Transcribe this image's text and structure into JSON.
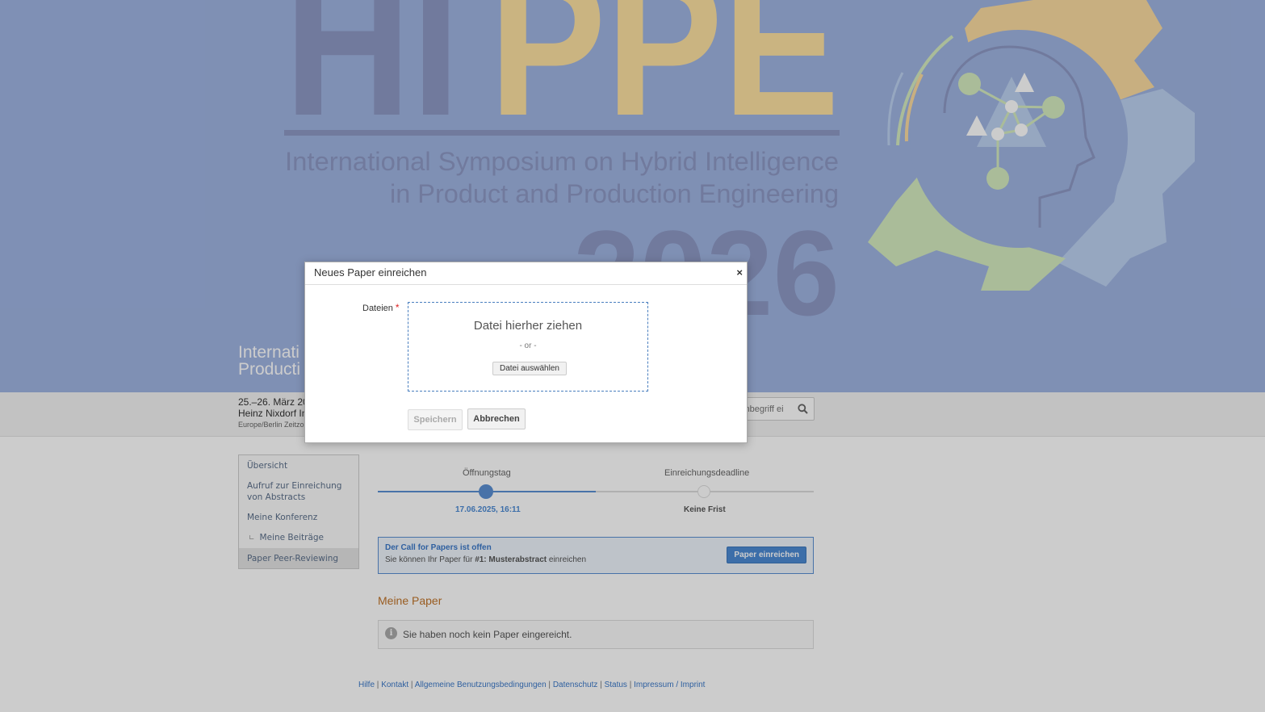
{
  "banner": {
    "logo_text": "HIPPE",
    "logo_subtitle_line1": "International Symposium on Hybrid Intelligence",
    "logo_subtitle_line2": "in Product and Production Engineering",
    "logo_year": "2026",
    "conference_title_line1": "Internati",
    "conference_title_line2": "Producti"
  },
  "infobar": {
    "dates": "25.–26. März 20",
    "venue": "Heinz Nixdorf In",
    "timezone": "Europe/Berlin Zeitzo",
    "search_placeholder": "chbegriff ei"
  },
  "sidebar": {
    "items": [
      {
        "label": "Übersicht"
      },
      {
        "label": "Aufruf zur Einreichung von Abstracts"
      },
      {
        "label": "Meine Konferenz"
      },
      {
        "label": "Meine Beiträge"
      },
      {
        "label": "Paper Peer-Reviewing"
      }
    ]
  },
  "timeline": {
    "start_label": "Öffnungstag",
    "start_date": "17.06.2025, 16:11",
    "end_label": "Einreichungsdeadline",
    "end_date": "Keine Frist",
    "progress": 0.5
  },
  "cfp": {
    "title": "Der Call for Papers ist offen",
    "text_prefix": "Sie können Ihr Paper für",
    "text_bold": "#1: Musterabstract",
    "text_suffix": "einreichen",
    "button_label": "Paper einreichen"
  },
  "my_papers": {
    "title": "Meine Paper",
    "info_text": "Sie haben noch kein Paper eingereicht."
  },
  "footer": {
    "links": [
      "Hilfe",
      "Kontakt",
      "Allgemeine Benutzungsbedingungen",
      "Datenschutz",
      "Status",
      "Impressum / Imprint"
    ],
    "separator": "|"
  },
  "dialog": {
    "title": "Neues Paper einreichen",
    "close_glyph": "×",
    "files_label": "Dateien",
    "required_marker": "*",
    "dropzone_text": "Datei hierher ziehen",
    "or_text": "- or -",
    "choose_file_label": "Datei auswählen",
    "save_label": "Speichern",
    "cancel_label": "Abbrechen"
  },
  "colors": {
    "banner_bg": "#9fb4e2",
    "logo_hi": "#8e99c5",
    "logo_ppe": "#fde2a2",
    "gear_gold": "#fbdba0",
    "gear_green": "#d5ecc0",
    "gear_blue": "#bcd1f1",
    "accent_blue": "#4c8ad4",
    "accent_orange": "#c0742a"
  }
}
